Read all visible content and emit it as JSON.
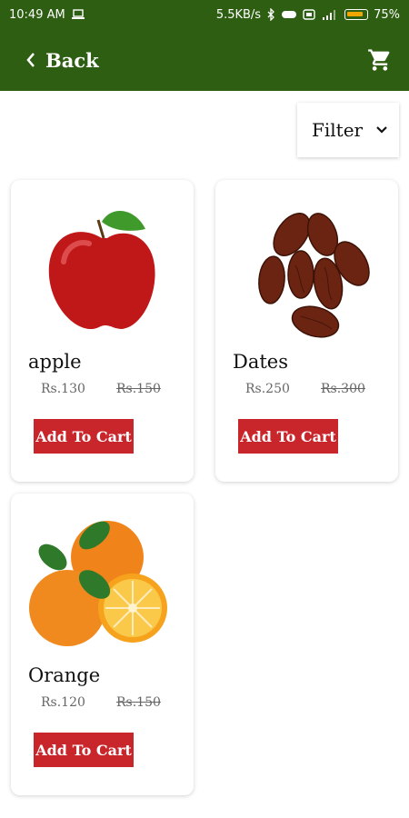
{
  "status_bar": {
    "time": "10:49 AM",
    "speed": "5.5KB/s",
    "battery": "75%"
  },
  "header": {
    "back_label": "Back"
  },
  "filter": {
    "label": "Filter"
  },
  "products": [
    {
      "name": "apple",
      "price": "Rs.130",
      "old_price": "Rs.150",
      "button": "Add To Cart"
    },
    {
      "name": "Dates",
      "price": "Rs.250",
      "old_price": "Rs.300",
      "button": "Add To Cart"
    },
    {
      "name": "Orange",
      "price": "Rs.120",
      "old_price": "Rs.150",
      "button": "Add To Cart"
    }
  ],
  "colors": {
    "header": "#2d5e12",
    "button": "#c9262c",
    "battery": "#f0a500"
  },
  "icons": [
    "laptop-icon",
    "bluetooth-icon",
    "alarm-icon",
    "signal-icon",
    "wifi-icon",
    "battery-icon",
    "chevron-left-icon",
    "cart-icon",
    "chevron-down-icon"
  ]
}
